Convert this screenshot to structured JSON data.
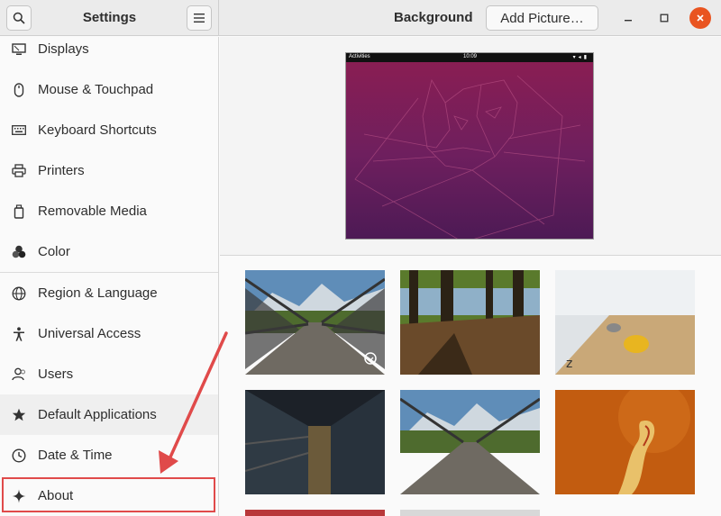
{
  "sidebar_header": {
    "title": "Settings"
  },
  "main_header": {
    "title": "Background",
    "add_picture_label": "Add Picture…"
  },
  "sidebar": {
    "items": [
      {
        "label": "Displays",
        "icon": "display-icon"
      },
      {
        "label": "Mouse & Touchpad",
        "icon": "mouse-icon"
      },
      {
        "label": "Keyboard Shortcuts",
        "icon": "keyboard-icon"
      },
      {
        "label": "Printers",
        "icon": "printer-icon"
      },
      {
        "label": "Removable Media",
        "icon": "removable-media-icon"
      },
      {
        "label": "Color",
        "icon": "color-icon"
      },
      {
        "label": "Region & Language",
        "icon": "globe-icon"
      },
      {
        "label": "Universal Access",
        "icon": "accessibility-icon"
      },
      {
        "label": "Users",
        "icon": "users-icon"
      },
      {
        "label": "Default Applications",
        "icon": "star-icon"
      },
      {
        "label": "Date & Time",
        "icon": "clock-icon"
      },
      {
        "label": "About",
        "icon": "sparkle-icon"
      }
    ]
  },
  "preview": {
    "activities": "Activities",
    "clock": "10:09"
  },
  "colors": {
    "accent": "#e95420",
    "annotation": "#e04a4a",
    "preview_top": "#8c1e52",
    "preview_bottom": "#4d1a55"
  }
}
